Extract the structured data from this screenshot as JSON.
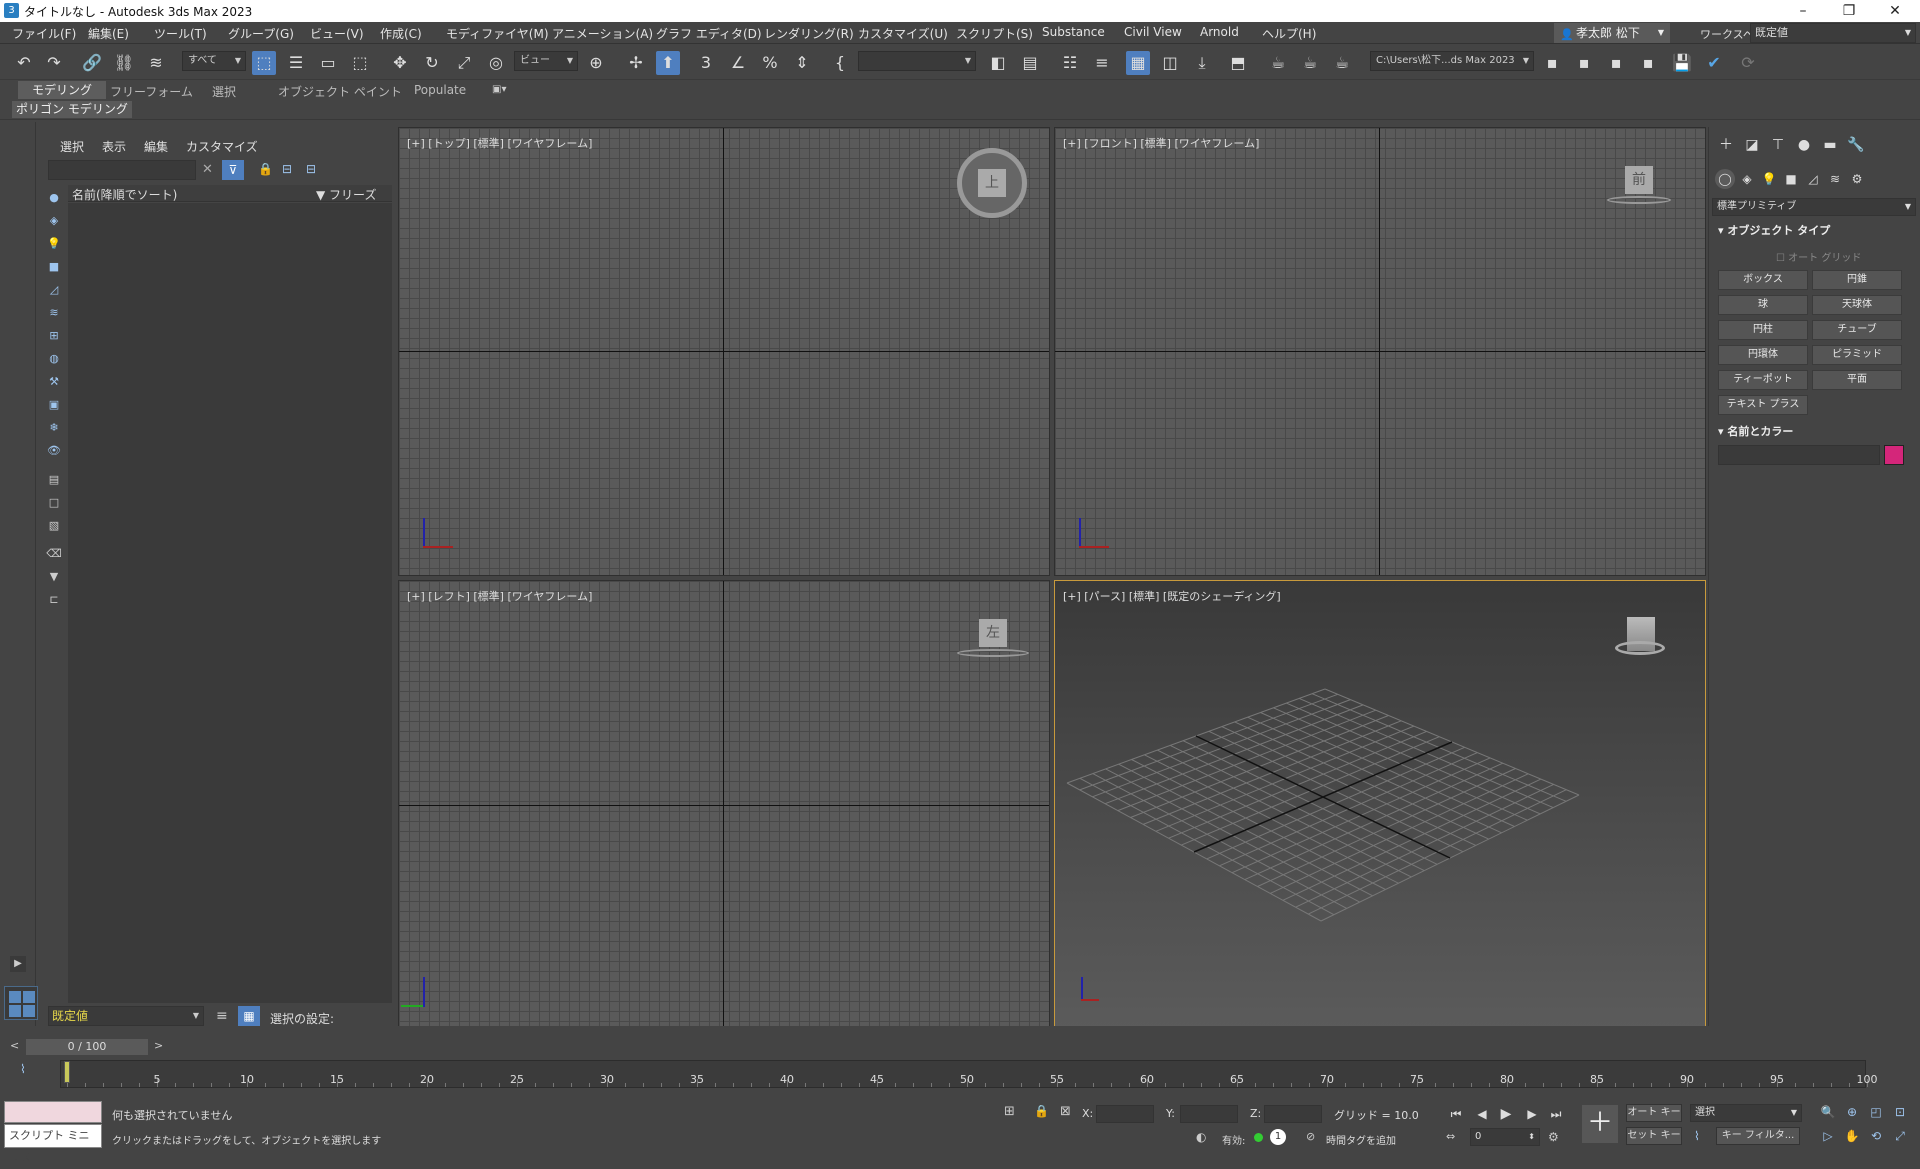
{
  "window": {
    "title": "タイトルなし - Autodesk 3ds Max 2023"
  },
  "menubar": {
    "items": [
      "ファイル(F)",
      "編集(E)",
      "ツール(T)",
      "グループ(G)",
      "ビュー(V)",
      "作成(C)",
      "モディファイヤ(M)",
      "アニメーション(A)",
      "グラフ エディタ(D)",
      "レンダリング(R)",
      "カスタマイズ(U)",
      "スクリプト(S)",
      "Substance",
      "Civil View",
      "Arnold",
      "ヘルプ(H)"
    ]
  },
  "user": {
    "name": "孝太郎 松下"
  },
  "workspace": {
    "label": "ワークスペース:",
    "value": "既定値"
  },
  "toolbar": {
    "selection_filter": "すべて",
    "ref_coord": "ビュー",
    "project_path": "C:\\Users\\松下...ds Max 2023"
  },
  "ribbon": {
    "tabs": [
      "モデリング",
      "フリーフォーム",
      "選択",
      "オブジェクト ペイント",
      "Populate"
    ],
    "panel": "ポリゴン モデリング"
  },
  "scene_explorer": {
    "menu": [
      "選択",
      "表示",
      "編集",
      "カスタマイズ"
    ],
    "col_name": "名前(降順でソート)",
    "col_freeze": "▼ フリーズ"
  },
  "viewports": [
    {
      "label": "[+] [トップ] [標準] [ワイヤフレーム]",
      "cube": "上"
    },
    {
      "label": "[+] [フロント] [標準] [ワイヤフレーム]",
      "cube": "前"
    },
    {
      "label": "[+] [レフト] [標準] [ワイヤフレーム]",
      "cube": "左"
    },
    {
      "label": "[+] [パース] [標準] [既定のシェーディング]",
      "cube": ""
    }
  ],
  "command_panel": {
    "category": "標準プリミティブ",
    "object_type_header": "オブジェクト タイプ",
    "autogrid": "オート グリッド",
    "buttons": [
      "ボックス",
      "円錐",
      "球",
      "天球体",
      "円柱",
      "チューブ",
      "円環体",
      "ピラミッド",
      "ティーポット",
      "平面",
      "テキスト プラス"
    ],
    "name_color_header": "名前とカラー",
    "color": "#d4267a"
  },
  "bottom": {
    "layer": "既定値",
    "selection_set": "選択の設定:",
    "frame": "0 / 100",
    "timeline_ticks": [
      "0",
      "5",
      "10",
      "15",
      "20",
      "25",
      "30",
      "35",
      "40",
      "45",
      "50",
      "55",
      "60",
      "65",
      "70",
      "75",
      "80",
      "85",
      "90",
      "95",
      "100"
    ],
    "script_mini": "スクリプト ミニ リス",
    "status1": "何も選択されていません",
    "status2": "クリックまたはドラッグをして、オブジェクトを選択します",
    "x_label": "X:",
    "y_label": "Y:",
    "z_label": "Z:",
    "grid": "グリッド = 10.0",
    "valid": "有効:",
    "timetag": "時間タグを追加",
    "autokey": "オート キー",
    "setkey": "セット キー",
    "selected": "選択",
    "keyfilter": "キー フィルタ...",
    "frame_value": "0"
  }
}
